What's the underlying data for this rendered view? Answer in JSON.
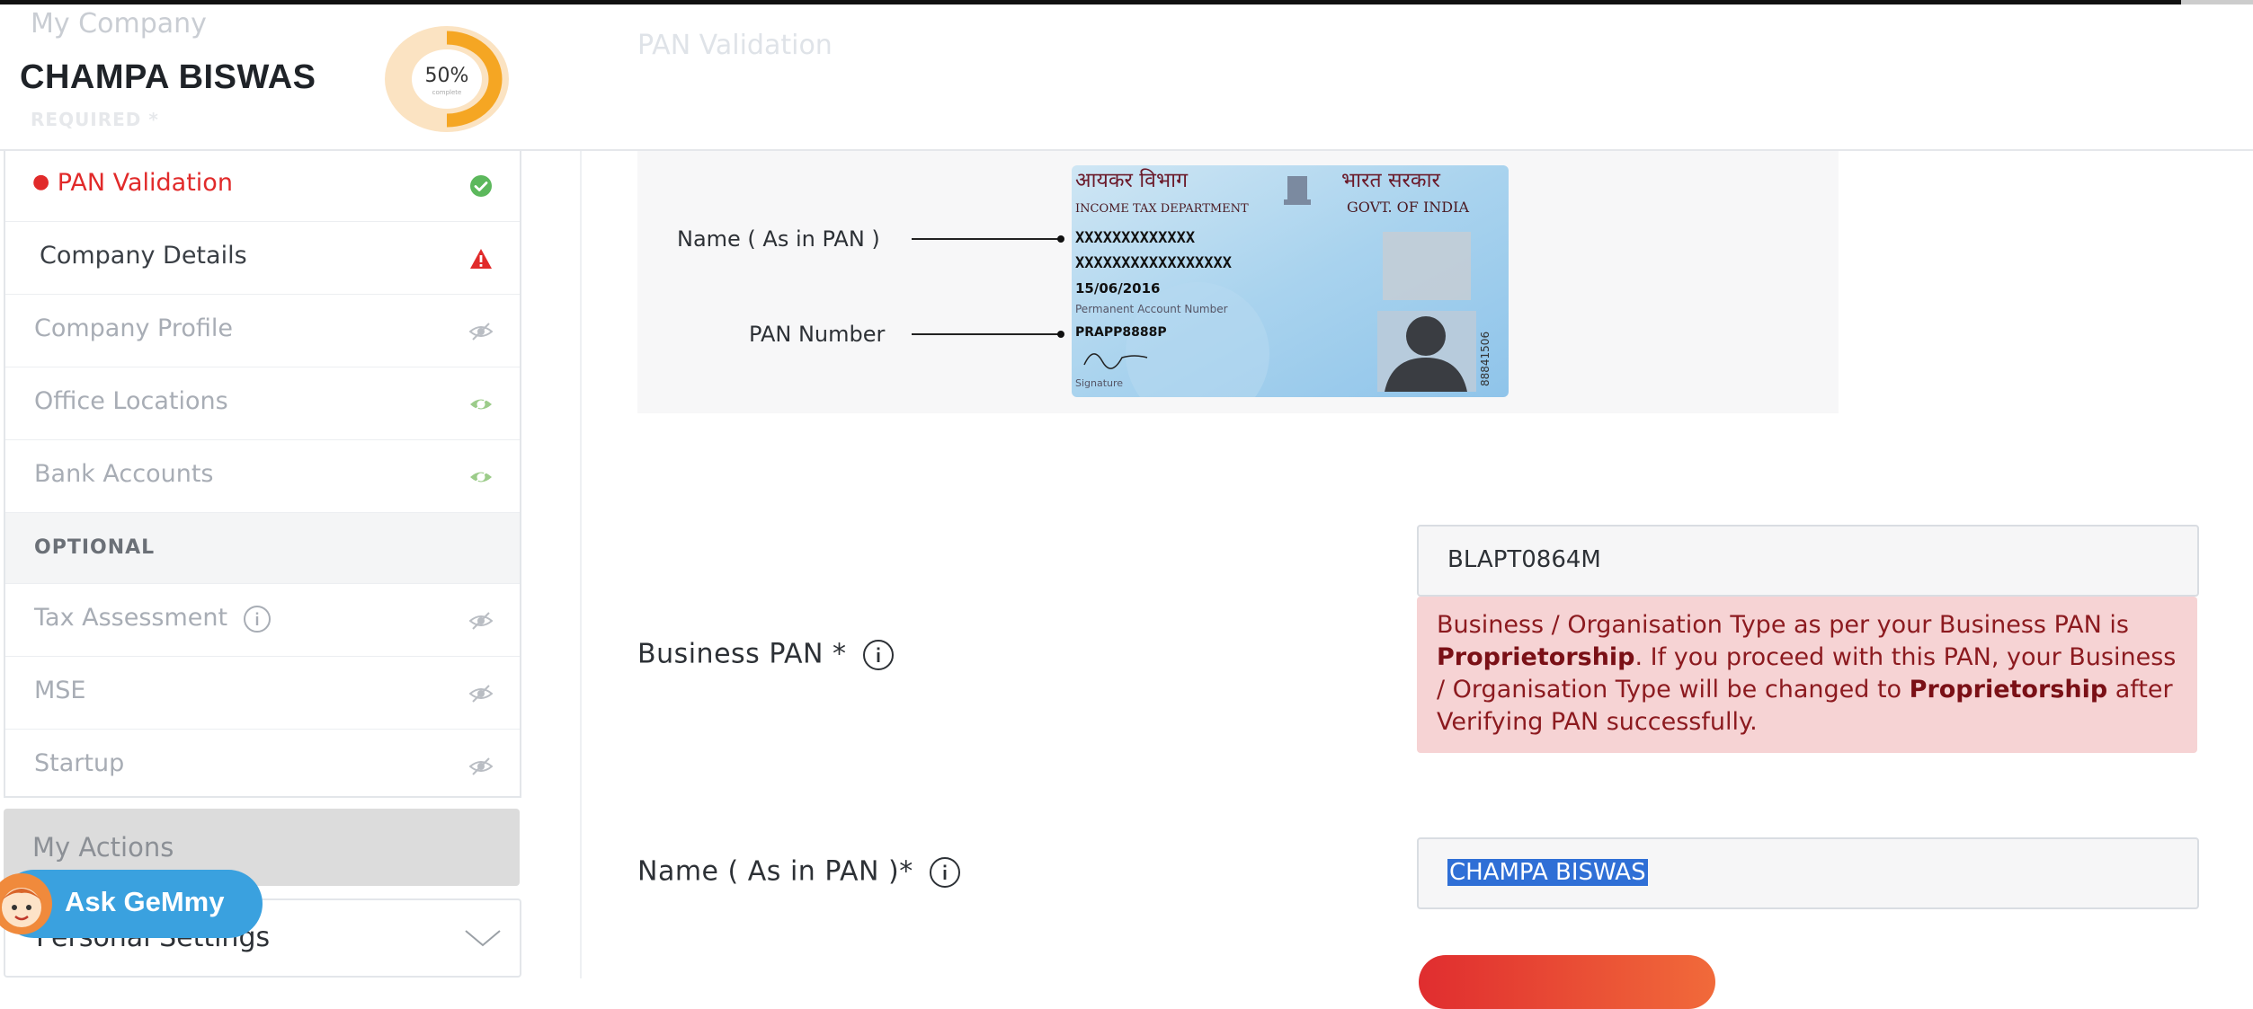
{
  "header": {
    "ghost_company": "My Company",
    "ghost_required": "REQUIRED *",
    "user_name": "CHAMPA BISWAS",
    "progress": {
      "value_pct": 50,
      "label": "50%",
      "sublabel": "complete"
    },
    "ghost_section_title": "PAN Validation"
  },
  "sidebar": {
    "required_items": [
      {
        "label": "PAN Validation",
        "status": "done",
        "status_icon": "check-circle-icon"
      },
      {
        "label": "Company Details",
        "status": "error",
        "status_icon": "warning-icon"
      },
      {
        "label": "Company Profile",
        "status": "locked",
        "status_icon": "eye-slash-icon"
      },
      {
        "label": "Office Locations",
        "status": "viewable",
        "status_icon": "eye-icon"
      },
      {
        "label": "Bank Accounts",
        "status": "viewable",
        "status_icon": "eye-icon"
      }
    ],
    "optional_heading": "OPTIONAL",
    "optional_items": [
      {
        "label": "Tax Assessment",
        "has_info": true,
        "status_icon": "eye-slash-icon"
      },
      {
        "label": "MSE",
        "status_icon": "eye-slash-icon"
      },
      {
        "label": "Startup",
        "status_icon": "eye-slash-icon"
      }
    ],
    "my_actions": "My Actions",
    "personal_settings": "Personal Settings"
  },
  "assistant": {
    "label": "Ask GeMmy"
  },
  "pan_card_example": {
    "name_label": "Name ( As in PAN )",
    "number_label": "PAN Number",
    "card_text": {
      "dept_hi": "आयकर विभाग",
      "govt_hi": "भारत सरकार",
      "dept_en": "INCOME TAX DEPARTMENT",
      "govt_en": "GOVT. OF INDIA",
      "name_mask": "XXXXXXXXXXXXX",
      "father_mask": "XXXXXXXXXXXXXXXXX",
      "dob": "15/06/2016",
      "pan_caption": "Permanent Account Number",
      "pan_example": "PRAPP8888P",
      "signature_caption": "Signature",
      "serial": "88841506"
    }
  },
  "form": {
    "business_pan": {
      "label": "Business PAN *",
      "value": "BLAPT0864M"
    },
    "alert": {
      "part1": "Business / Organisation Type as per your Business PAN is ",
      "bold1": "Proprietorship",
      "part2": ". If you proceed with this PAN, your Business / Organisation Type will be changed to ",
      "bold2": "Proprietorship",
      "part3": " after Verifying PAN successfully."
    },
    "name_as_pan": {
      "label": "Name ( As in PAN )*",
      "value": "CHAMPA BISWAS"
    }
  },
  "colors": {
    "accent_red": "#e12a2a",
    "progress_orange": "#f5a623",
    "success_green": "#5cb85c",
    "alert_bg": "#f6d3d4",
    "assistant_blue": "#3aa1df"
  }
}
